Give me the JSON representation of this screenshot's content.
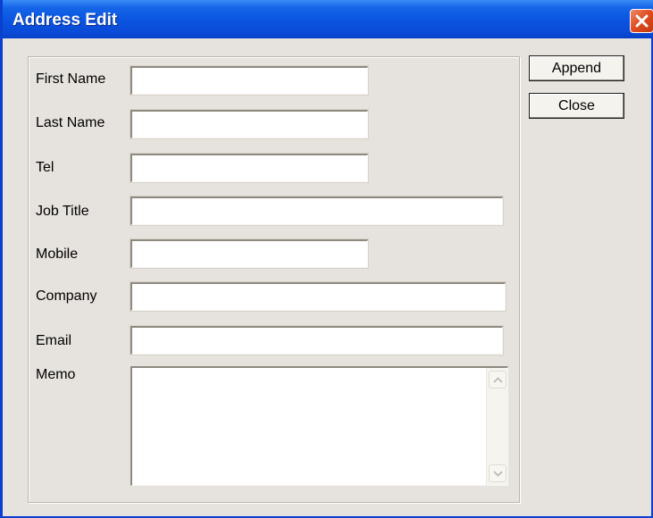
{
  "window": {
    "title": "Address Edit"
  },
  "form": {
    "first_name_label": "First Name",
    "last_name_label": "Last Name",
    "tel_label": "Tel",
    "job_title_label": "Job Title",
    "mobile_label": "Mobile",
    "company_label": "Company",
    "email_label": "Email",
    "memo_label": "Memo",
    "first_name_value": "",
    "last_name_value": "",
    "tel_value": "",
    "job_title_value": "",
    "mobile_value": "",
    "company_value": "",
    "email_value": "",
    "memo_value": ""
  },
  "buttons": {
    "append": "Append",
    "close": "Close"
  },
  "icons": {
    "close": "close-icon",
    "scroll_up": "scroll-up-arrow-icon",
    "scroll_down": "scroll-down-arrow-icon"
  },
  "colors": {
    "titlebar": "#0a54e0",
    "close_button": "#e04a1e",
    "dialog_bg": "#e6e3de"
  }
}
